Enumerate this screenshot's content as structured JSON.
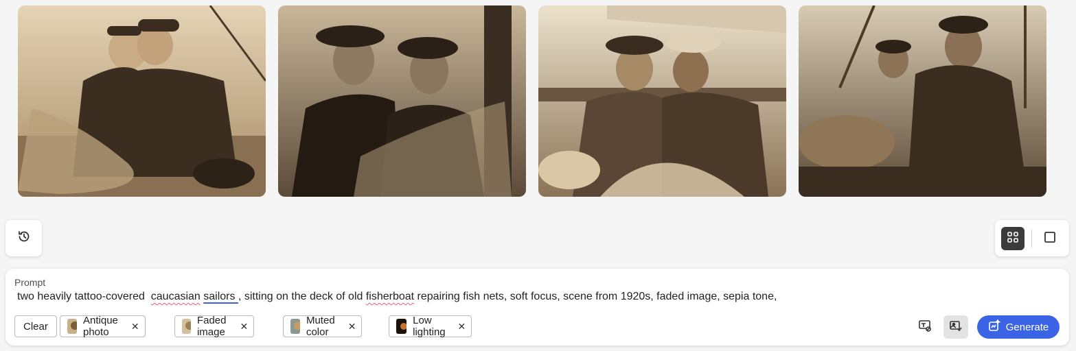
{
  "images": [
    {
      "name": "image-1",
      "alt": ""
    },
    {
      "name": "image-2",
      "alt": ""
    },
    {
      "name": "image-3",
      "alt": ""
    },
    {
      "name": "image-4",
      "alt": ""
    }
  ],
  "history": {
    "icon": "history-icon"
  },
  "view_toggle": {
    "grid_icon": "grid-view-icon",
    "single_icon": "single-view-icon",
    "active": "grid"
  },
  "prompt": {
    "label": "Prompt",
    "text_parts": [
      "two heavily tattoo-covered  ",
      "caucasian",
      " ",
      "sailors ",
      ", sitting on the deck of old ",
      "fisherboat",
      " repairing fish nets, soft focus, scene from 1920s, faded image, sepia tone,"
    ]
  },
  "chips": {
    "clear_label": "Clear",
    "items": [
      {
        "label": "Antique photo",
        "swatch": "#9a7a52"
      },
      {
        "label": "Faded image",
        "swatch": "#b59a70"
      },
      {
        "label": "Muted color",
        "swatch": "#7d8a84"
      },
      {
        "label": "Low lighting",
        "swatch": "#3a2a1a"
      }
    ],
    "remove_symbol": "✕"
  },
  "toolbar": {
    "settings_icon": "text-settings-icon",
    "style_icon": "style-reference-icon",
    "generate_label": "Generate",
    "generate_icon": "sparkle-icon"
  },
  "colors": {
    "accent": "#3b63e6",
    "sepia_dark": "#2e2418",
    "sepia_light": "#d9c6a4"
  }
}
